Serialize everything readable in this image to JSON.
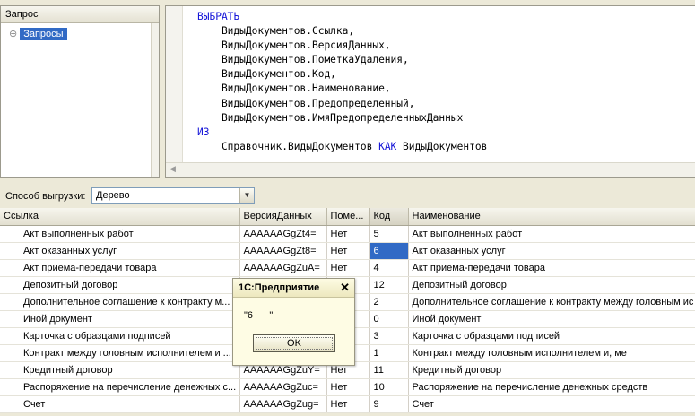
{
  "tree_panel": {
    "header": "Запрос",
    "node_label": "Запросы"
  },
  "query_text": [
    [
      {
        "t": "ВЫБРАТЬ",
        "k": true
      }
    ],
    [
      {
        "t": "    ВидыДокументов.Ссылка,",
        "k": false
      }
    ],
    [
      {
        "t": "    ВидыДокументов.ВерсияДанных,",
        "k": false
      }
    ],
    [
      {
        "t": "    ВидыДокументов.ПометкаУдаления,",
        "k": false
      }
    ],
    [
      {
        "t": "    ВидыДокументов.Код,",
        "k": false
      }
    ],
    [
      {
        "t": "    ВидыДокументов.Наименование,",
        "k": false
      }
    ],
    [
      {
        "t": "    ВидыДокументов.Предопределенный,",
        "k": false
      }
    ],
    [
      {
        "t": "    ВидыДокументов.ИмяПредопределенныхДанных",
        "k": false
      }
    ],
    [
      {
        "t": "ИЗ",
        "k": true
      }
    ],
    [
      {
        "t": "    Справочник.ВидыДокументов ",
        "k": false
      },
      {
        "t": "КАК",
        "k": true
      },
      {
        "t": " ВидыДокументов",
        "k": false
      }
    ]
  ],
  "export": {
    "label": "Способ выгрузки:",
    "value": "Дерево"
  },
  "table": {
    "columns": [
      {
        "label": "Ссылка",
        "width": 267
      },
      {
        "label": "ВерсияДанных",
        "width": 97
      },
      {
        "label": "Поме...",
        "width": 48
      },
      {
        "label": "Код",
        "width": 43
      },
      {
        "label": "Наименование",
        "width": 320
      }
    ],
    "sorted_column": 3,
    "selected": {
      "row": 1,
      "col": 3
    },
    "rows": [
      [
        "Акт выполненных работ",
        "AAAAAAGgZt4=",
        "Нет",
        "5",
        "Акт выполненных работ"
      ],
      [
        "Акт оказанных услуг",
        "AAAAAAGgZt8=",
        "Нет",
        "6",
        "Акт оказанных услуг"
      ],
      [
        "Акт приема-передачи товара",
        "AAAAAAGgZuA=",
        "Нет",
        "4",
        "Акт приема-передачи товара"
      ],
      [
        "Депозитный договор",
        "",
        "",
        "12",
        "Депозитный договор"
      ],
      [
        "Дополнительное соглашение к контракту м...",
        "",
        "",
        "2",
        "Дополнительное соглашение к контракту между головным ис"
      ],
      [
        "Иной документ",
        "",
        "",
        "0",
        "Иной документ"
      ],
      [
        "Карточка с образцами подписей",
        "",
        "",
        "3",
        "Карточка с образцами подписей"
      ],
      [
        "Контракт между головным исполнителем и ...",
        "",
        "",
        "1",
        "Контракт между головным исполнителем и, ме"
      ],
      [
        "Кредитный договор",
        "AAAAAAGgZuY=",
        "Нет",
        "11",
        "Кредитный договор"
      ],
      [
        "Распоряжение на перечисление денежных с...",
        "AAAAAAGgZuc=",
        "Нет",
        "10",
        "Распоряжение на перечисление денежных средств"
      ],
      [
        "Счет",
        "AAAAAAGgZug=",
        "Нет",
        "9",
        "Счет"
      ]
    ]
  },
  "message_box": {
    "title": "1С:Предприятие",
    "close": "✕",
    "text": "\"6      \"",
    "ok_label": "OK"
  }
}
